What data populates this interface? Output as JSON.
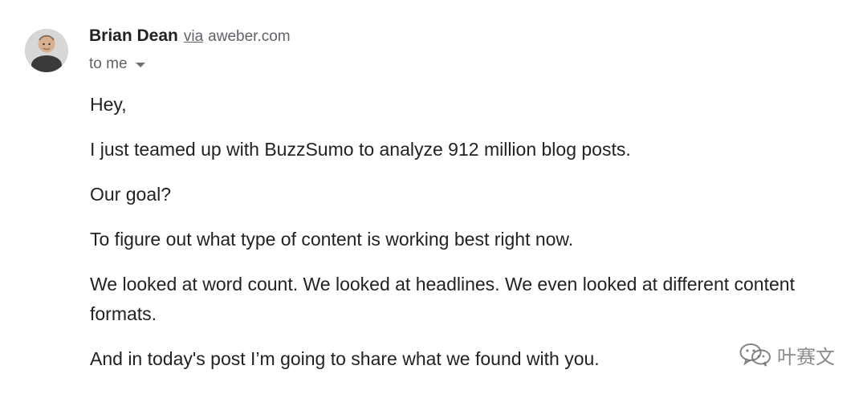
{
  "sender": {
    "name": "Brian Dean",
    "via_label": "via",
    "domain": "aweber.com"
  },
  "recipient": {
    "label": "to me"
  },
  "message": {
    "paragraphs": [
      "Hey,",
      "I just teamed up with BuzzSumo to analyze 912 million blog posts.",
      "Our goal?",
      "To figure out what type of content is working best right now.",
      "We looked at word count. We looked at headlines. We even looked at different content formats.",
      "And in today's post I’m going to share what we found with you."
    ]
  },
  "watermark": {
    "text": "叶赛文"
  },
  "icons": {
    "avatar": "avatar",
    "recipient_toggle": "chevron-down-icon",
    "watermark": "wechat-icon"
  }
}
